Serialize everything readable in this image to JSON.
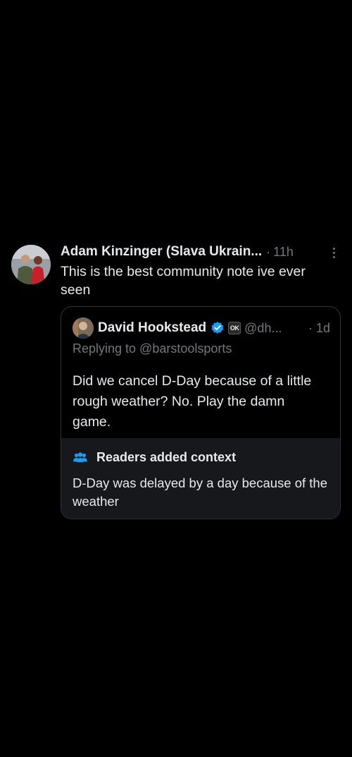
{
  "tweet": {
    "author_name": "Adam Kinzinger (Slava Ukrain...",
    "separator": "·",
    "time": "11h",
    "text": "This is the best community note ive ever seen",
    "more_icon": "more-vertical-icon"
  },
  "quoted": {
    "author_name": "David Hookstead",
    "verified_icon": "verified-badge-icon",
    "affiliate_badge": "OK",
    "handle": "@dh...",
    "time": "· 1d",
    "replying_to": "Replying to @barstoolsports",
    "text": "Did we cancel D-Day because of a little rough weather? No. Play the damn game."
  },
  "context": {
    "icon": "people-icon",
    "title": "Readers added context",
    "text": "D-Day was delayed by a day because of the weather"
  },
  "colors": {
    "background": "#000000",
    "primary_text": "#e7e9ea",
    "secondary_text": "#71767b",
    "accent_blue": "#1d9bf0",
    "context_background": "#16181c"
  }
}
